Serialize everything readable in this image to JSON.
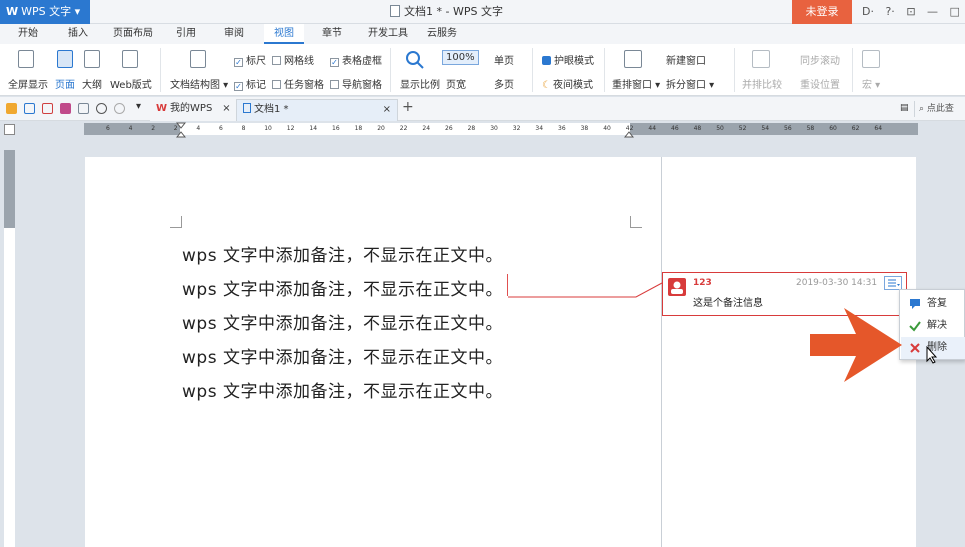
{
  "app": {
    "name": "WPS 文字",
    "logo": "W",
    "title": "文档1 * - WPS 文字",
    "login": "未登录",
    "controls": [
      "D·",
      "?·",
      "⊡",
      "—",
      "□"
    ]
  },
  "colors": {
    "accent": "#2b78d0",
    "login_bg": "#e8623f",
    "comment_red": "#d83b3b",
    "arrow": "#e5572a"
  },
  "menu": {
    "tabs": [
      "开始",
      "插入",
      "页面布局",
      "引用",
      "审阅",
      "视图",
      "章节",
      "开发工具",
      "云服务"
    ],
    "active": "视图"
  },
  "ribbon": {
    "fullscreen": "全屏显示",
    "page": "页面",
    "outline": "大纲",
    "web": "Web版式",
    "doc_structure": "文档结构图",
    "ruler": "标尺",
    "bookmark": "标记",
    "gridlines": "网格线",
    "task_pane": "任务窗格",
    "table_gridlines": "表格虚框",
    "nav_pane": "导航窗格",
    "zoom_ratio": "显示比例",
    "zoom_value": "100%",
    "page_width": "页宽",
    "single_page": "单页",
    "multi_page": "多页",
    "eye_protect": "护眼模式",
    "night_mode": "夜间模式",
    "arrange_windows": "重排窗口",
    "new_window": "新建窗口",
    "split_window": "拆分窗口",
    "side_by_side": "并排比较",
    "sync_scroll": "同步滚动",
    "reset_position": "重设位置",
    "macro": "宏"
  },
  "quickbar": {
    "tab_mywps": "我的WPS",
    "tab_doc": "文档1 *",
    "add": "+",
    "search_placeholder": "点此查"
  },
  "ruler": {
    "marks": [
      "6",
      "4",
      "2",
      "2",
      "4",
      "6",
      "8",
      "10",
      "12",
      "14",
      "16",
      "18",
      "20",
      "22",
      "24",
      "26",
      "28",
      "30",
      "32",
      "34",
      "36",
      "38",
      "40",
      "42",
      "44",
      "46",
      "48",
      "50",
      "52",
      "54",
      "56",
      "58",
      "60",
      "62",
      "64"
    ]
  },
  "document": {
    "lines": [
      "wps 文字中添加备注，不显示在正文中。",
      "wps 文字中添加备注，不显示在正文中。",
      "wps 文字中添加备注，不显示在正文中。",
      "wps 文字中添加备注，不显示在正文中。",
      "wps 文字中添加备注，不显示在正文中。"
    ]
  },
  "comment": {
    "user": "123",
    "time": "2019-03-30 14:31",
    "text": "这是个备注信息"
  },
  "context_menu": {
    "reply": "答复",
    "resolve": "解决",
    "delete": "删除"
  }
}
